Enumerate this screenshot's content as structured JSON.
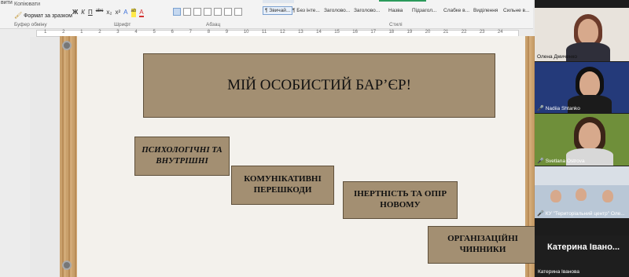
{
  "ribbon": {
    "cut": "вити",
    "copy": "Копіювати",
    "format_painter": "Формат за зразком",
    "clipboard_label": "Буфер обміну",
    "font_label": "Шрифт",
    "paragraph_label": "Абзац",
    "styles_label": "Стилі",
    "font_buttons": [
      "Ж",
      "К",
      "П",
      "abc",
      "x₂",
      "x²",
      "А",
      "ab",
      "А"
    ],
    "styles": [
      "¶ Звичай...",
      "¶ Без інте...",
      "Заголово...",
      "Заголово...",
      "Назва",
      "Підзагол...",
      "Слабке в...",
      "Виділення",
      "Сильне в..."
    ]
  },
  "ruler": {
    "numbers": [
      "1",
      "2",
      "1",
      "2",
      "3",
      "4",
      "5",
      "6",
      "7",
      "8",
      "9",
      "10",
      "11",
      "12",
      "13",
      "14",
      "15",
      "16",
      "17",
      "18",
      "19",
      "20",
      "21",
      "22",
      "23",
      "24"
    ]
  },
  "slide": {
    "title": "МІЙ ОСОБИСТИЙ БАР’ЄР!",
    "boxes": [
      "ПСИХОЛОГІЧНІ ТА ВНУТРІШНІ",
      "КОМУНІКАТИВНІ ПЕРЕШКОДИ",
      "ІНЕРТНІСТЬ ТА ОПІР НОВОМУ",
      "ОРГАНІЗАЦІЙНІ ЧИННИКИ"
    ]
  },
  "participants": [
    {
      "name": "Олена Дмиченко"
    },
    {
      "name": "Nadiia Shtanko"
    },
    {
      "name": "Svetlana Ostrova"
    },
    {
      "name": "КУ \"Територіальний центр\" Оле..."
    },
    {
      "name": "Катерина Івано...",
      "subtitle": "Катерина Іванова"
    }
  ]
}
